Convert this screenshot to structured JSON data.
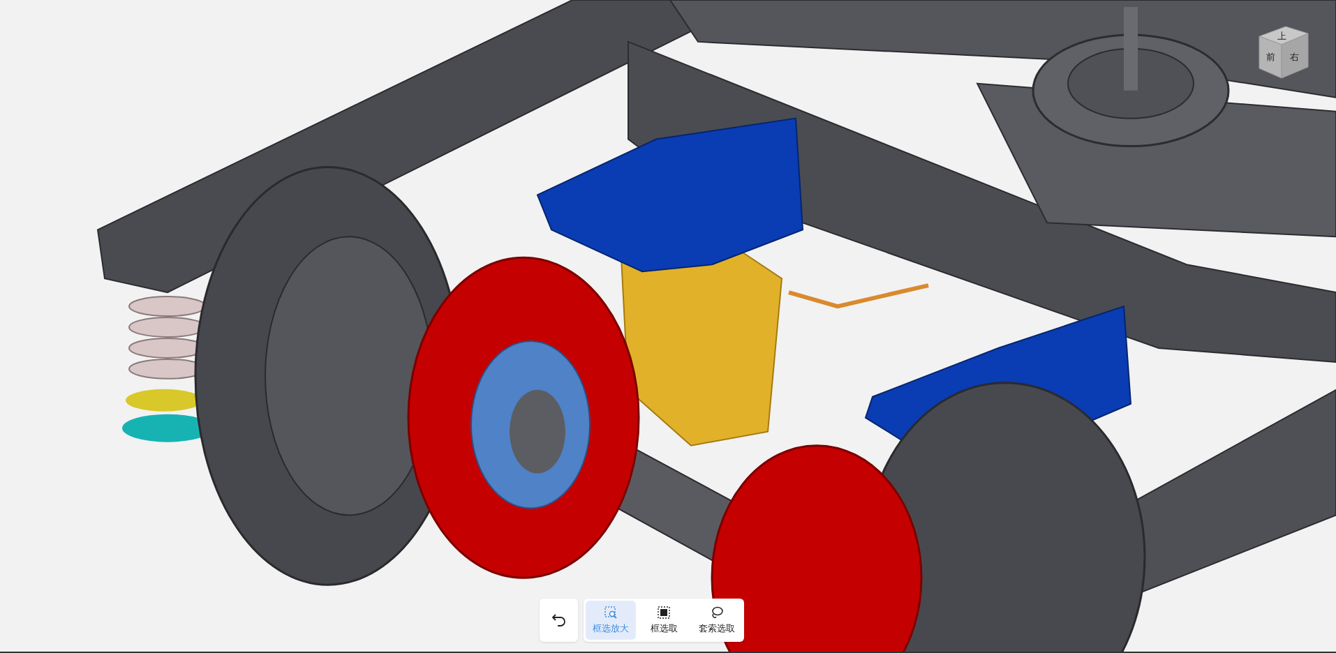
{
  "view_cube": {
    "faces": [
      {
        "kind": "top",
        "label": "上"
      },
      {
        "kind": "front",
        "label": "前"
      },
      {
        "kind": "right",
        "label": "右"
      }
    ]
  },
  "toolbar": {
    "tools": [
      {
        "kind": "zoom-box",
        "label": "框选放大",
        "selected": true
      },
      {
        "kind": "box-select",
        "label": "框选取",
        "selected": false
      },
      {
        "kind": "lasso",
        "label": "套索选取",
        "selected": false
      }
    ]
  }
}
